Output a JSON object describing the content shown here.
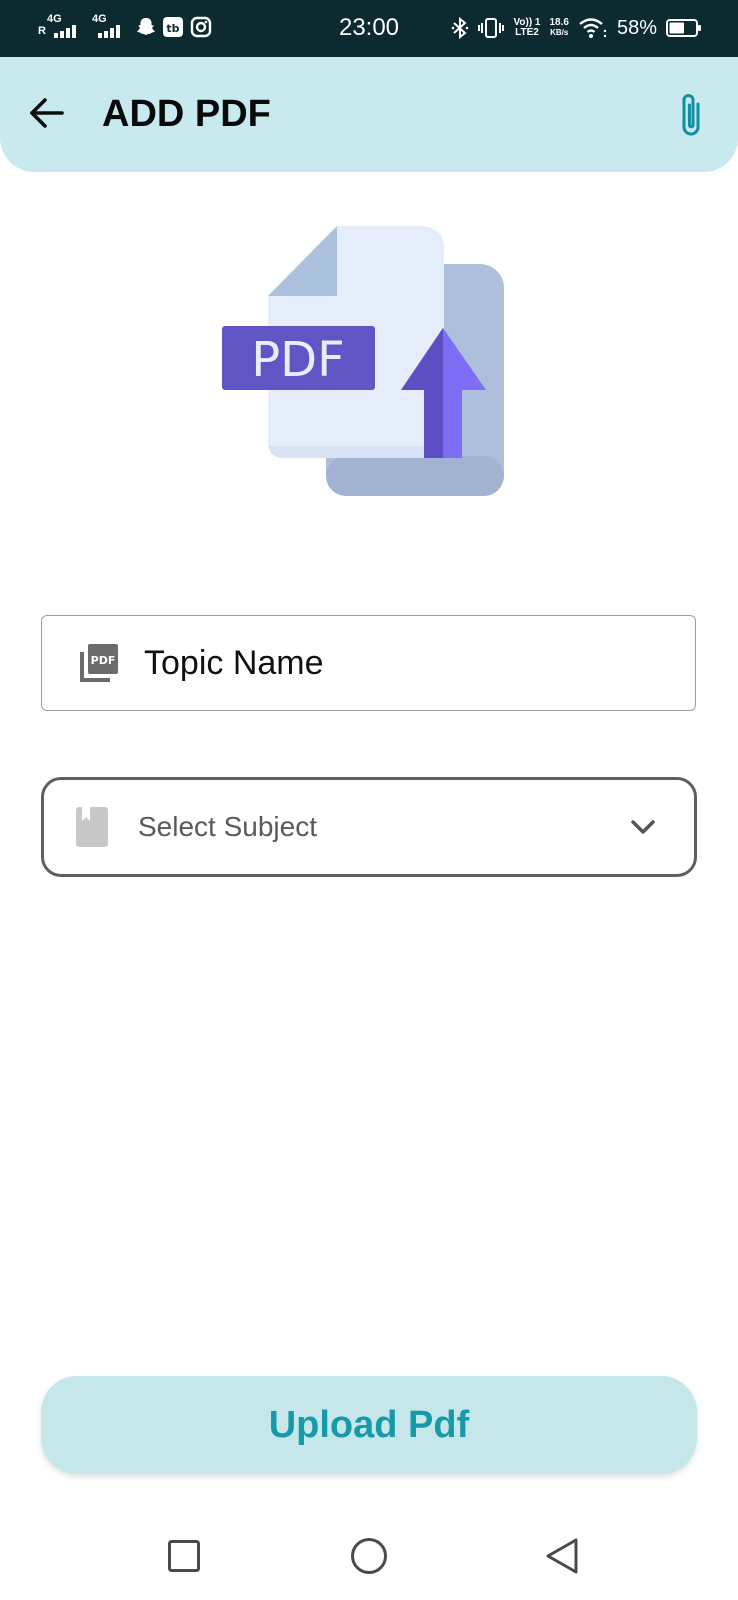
{
  "status_bar": {
    "time": "23:00",
    "net1": "4G",
    "net1_roaming": "R",
    "net2": "4G",
    "volte_top": "Vo)) 1",
    "volte_bottom": "LTE2",
    "speed_value": "18.6",
    "speed_unit": "KB/s",
    "battery": "58%",
    "battery_level": 0.58
  },
  "app_bar": {
    "title": "ADD PDF",
    "background": "#c8e9ee"
  },
  "illustration": {
    "badge_text": "PDF",
    "badge_color": "#5f55c5",
    "arrow_color": "#7a67f2"
  },
  "form": {
    "topic_placeholder": "Topic Name",
    "topic_value": "",
    "subject_placeholder": "Select Subject"
  },
  "upload": {
    "label": "Upload Pdf",
    "text_color": "#1699a8"
  },
  "icons": {
    "back": "arrow-left-icon",
    "attach": "paperclip-icon",
    "topic": "pdf-file-icon",
    "subject": "book-icon",
    "dropdown": "chevron-down-icon",
    "nav_recent": "square-icon",
    "nav_home": "circle-icon",
    "nav_back": "triangle-back-icon"
  }
}
